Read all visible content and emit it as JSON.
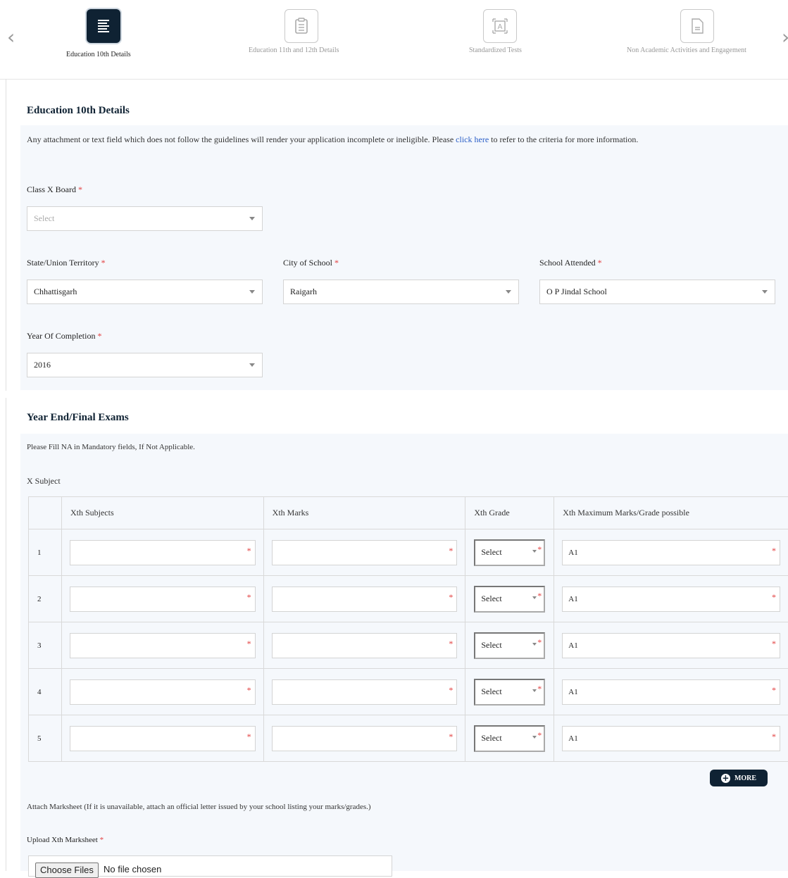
{
  "stepper": {
    "steps": [
      {
        "label": "Education 10th Details",
        "icon": "list-icon",
        "active": true
      },
      {
        "label": "Education 11th and 12th Details",
        "icon": "clipboard-icon",
        "active": false
      },
      {
        "label": "Standardized Tests",
        "icon": "test-icon",
        "active": false
      },
      {
        "label": "Non Academic Activities and Engagement",
        "icon": "document-icon",
        "active": false
      }
    ]
  },
  "education10": {
    "title": "Education 10th Details",
    "note_before": "Any attachment or text field which does not follow the guidelines will render your application incomplete or ineligible. Please ",
    "note_link": "click here",
    "note_after": " to refer to the criteria for more information.",
    "board": {
      "label": "Class X Board",
      "placeholder": "Select"
    },
    "state": {
      "label": "State/Union Territory",
      "value": "Chhattisgarh"
    },
    "city": {
      "label": "City of School",
      "value": "Raigarh"
    },
    "school": {
      "label": "School Attended",
      "value": "O P Jindal School"
    },
    "year": {
      "label": "Year Of Completion",
      "value": "2016"
    },
    "required_mark": "*"
  },
  "exams": {
    "title": "Year End/Final Exams",
    "note": "Please Fill NA in Mandatory fields, If Not Applicable.",
    "subject_label": "X Subject",
    "columns": [
      "Xth Subjects",
      "Xth Marks",
      "Xth Grade",
      "Xth Maximum Marks/Grade possible"
    ],
    "rows": [
      {
        "num": "1",
        "grade": "Select",
        "max": "A1"
      },
      {
        "num": "2",
        "grade": "Select",
        "max": "A1"
      },
      {
        "num": "3",
        "grade": "Select",
        "max": "A1"
      },
      {
        "num": "4",
        "grade": "Select",
        "max": "A1"
      },
      {
        "num": "5",
        "grade": "Select",
        "max": "A1"
      }
    ],
    "more_label": "MORE",
    "attach_note": "Attach Marksheet (If it is unavailable, attach an official letter issued by your school listing your marks/grades.)",
    "upload_label": "Upload Xth Marksheet",
    "choose_files": "Choose Files",
    "file_status": "No file chosen"
  },
  "colors": {
    "accent": "#0f2233",
    "link": "#2a5ec7",
    "required": "#e23b3b",
    "panel": "#f5f8fc"
  }
}
